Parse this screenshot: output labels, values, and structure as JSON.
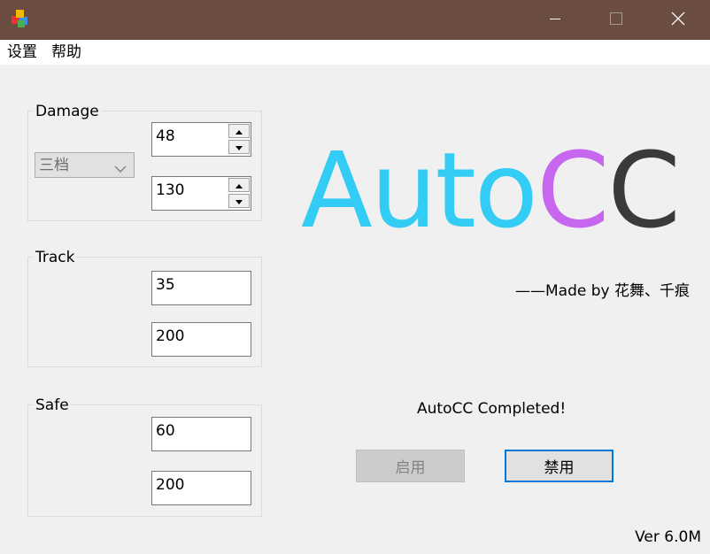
{
  "menu": {
    "items": [
      {
        "label": "设置"
      },
      {
        "label": "帮助"
      }
    ]
  },
  "groups": {
    "damage": {
      "label": "Damage",
      "combo_value": "三档",
      "spin1_value": "48",
      "spin2_value": "130"
    },
    "track": {
      "label": "Track",
      "field1_value": "35",
      "field2_value": "200"
    },
    "safe": {
      "label": "Safe",
      "field1_value": "60",
      "field2_value": "200"
    }
  },
  "logo": {
    "part1": "Auto",
    "part2": "C",
    "part3": "C",
    "colors": {
      "auto": "#33ccf4",
      "c1": "#c766ee",
      "c2": "#3a3a3a"
    }
  },
  "made_by": "——Made by 花舞、千痕",
  "status_text": "AutoCC Completed!",
  "buttons": {
    "enable_label": "启用",
    "disable_label": "禁用"
  },
  "version": "Ver 6.0M",
  "icons": {
    "app": "app-cubes-icon",
    "minimize": "minimize-icon",
    "maximize": "maximize-icon",
    "close": "close-icon",
    "up": "arrow-up-icon",
    "down": "arrow-down-icon",
    "combo": "chevron-down-icon"
  },
  "theme": {
    "titlebar": "#6b4c40",
    "accent": "#0078d7"
  }
}
